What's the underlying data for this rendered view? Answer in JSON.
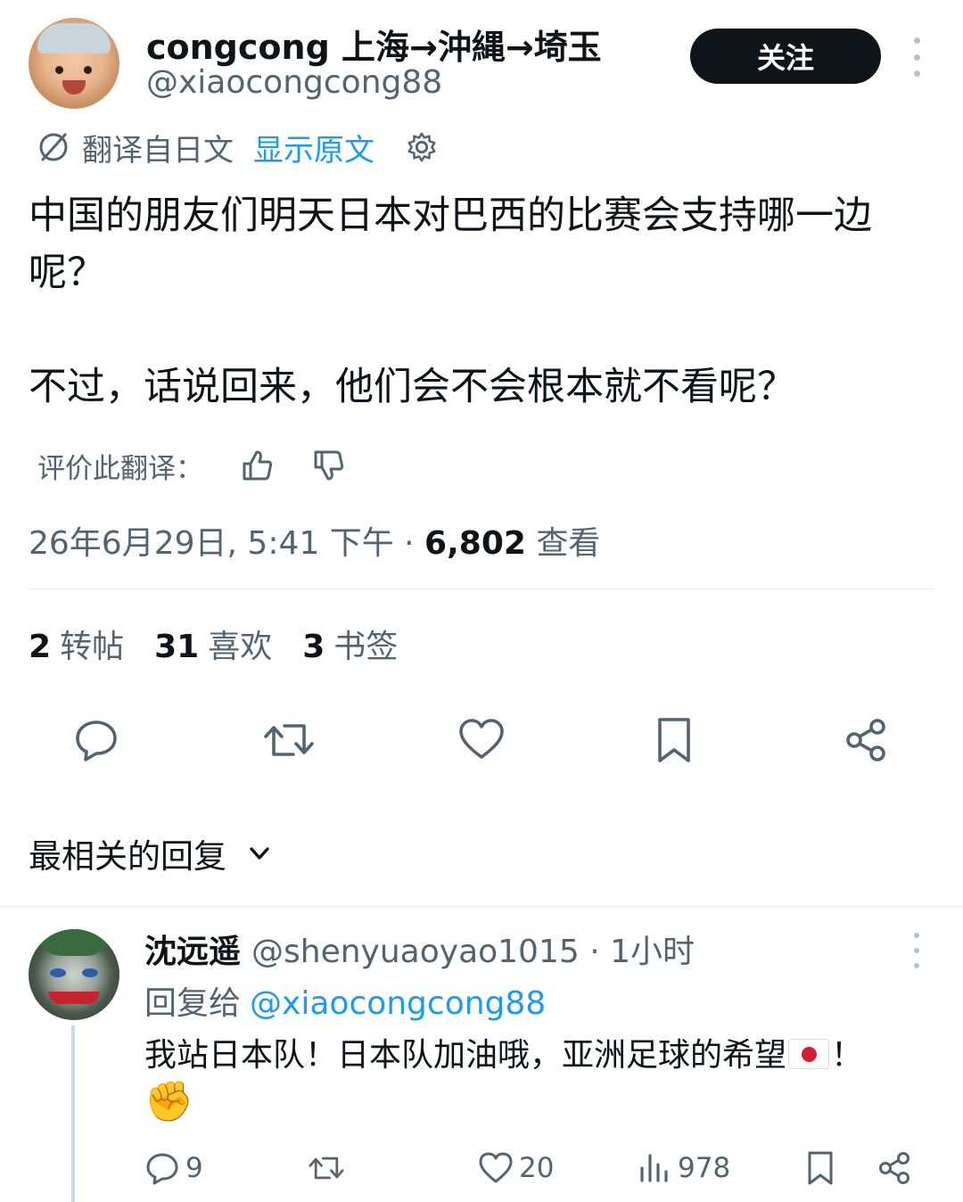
{
  "header": {
    "display_name": "congcong 上海→沖縄→埼玉",
    "handle": "@xiaocongcong88",
    "follow_label": "关注"
  },
  "translation": {
    "from_label": "翻译自日文",
    "show_original_label": "显示原文"
  },
  "tweet": {
    "text": "中国的朋友们明天日本对巴西的比赛会支持哪一边呢？\n\n不过，话说回来，他们会不会根本就不看呢？",
    "rate_label": "评价此翻译：",
    "timestamp": "26年6月29日, 5:41 下午",
    "separator": " · ",
    "views_count": "6,802",
    "views_label": " 查看"
  },
  "stats": {
    "reposts_count": "2",
    "reposts_label": "转帖",
    "likes_count": "31",
    "likes_label": "喜欢",
    "bookmarks_count": "3",
    "bookmarks_label": "书签"
  },
  "replies_sort_label": "最相关的回复",
  "reply": {
    "name": "沈远遥",
    "handle_time": "@shenyuaoyao1015 · 1小时",
    "replying_to_label": "回复给",
    "replying_to_handle": "@xiaocongcong88",
    "text_part1": "我站日本队！日本队加油哦，亚洲足球的希望",
    "text_part2": "！",
    "fist_emoji": "✊",
    "replies_count": "9",
    "likes_count": "20",
    "views_count": "978"
  },
  "colors": {
    "text": "#0f1419",
    "secondary": "#536471",
    "link": "#1d9bf0",
    "divider": "#e3e7ea"
  },
  "icons": [
    "translate-icon",
    "gear-icon",
    "thumbs-up-icon",
    "thumbs-down-icon",
    "reply-icon",
    "repost-icon",
    "like-icon",
    "bookmark-icon",
    "share-icon",
    "chevron-down-icon",
    "analytics-icon",
    "more-icon"
  ]
}
